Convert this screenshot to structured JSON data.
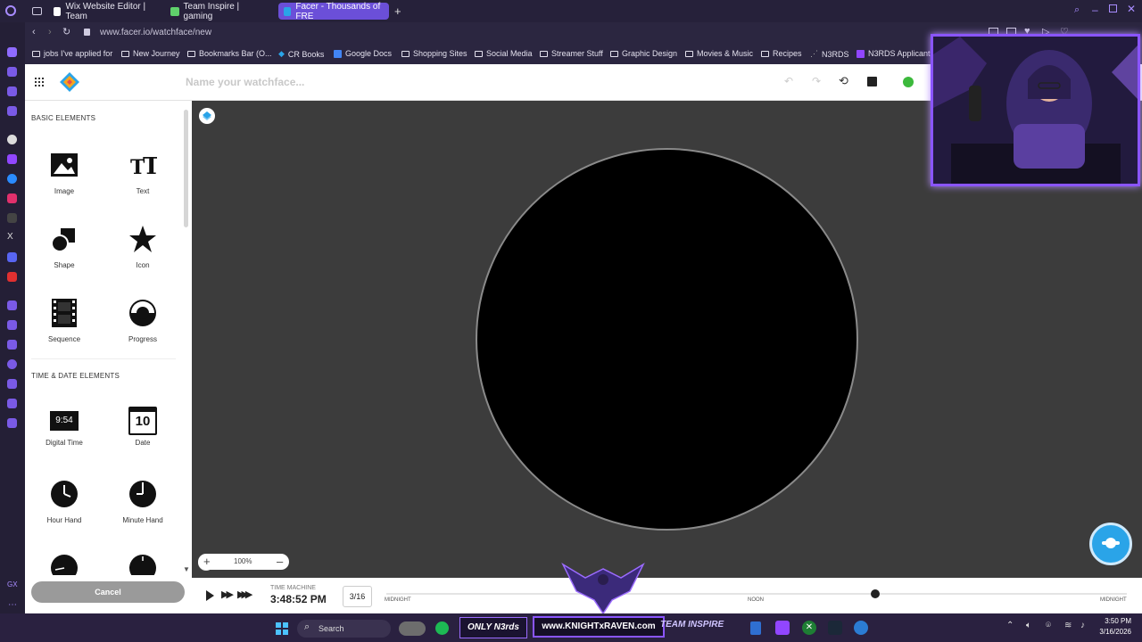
{
  "browser": {
    "tabs": [
      {
        "label": "Wix Website Editor | Team",
        "active": false
      },
      {
        "label": "Team Inspire | gaming",
        "active": false
      },
      {
        "label": "Facer - Thousands of FRE",
        "active": true
      }
    ],
    "url": "www.facer.io/watchface/new",
    "bookmarks": [
      "jobs I've applied for",
      "New Journey",
      "Bookmarks Bar (O...",
      "CR Books",
      "Google Docs",
      "Shopping Sites",
      "Social Media",
      "Streamer Stuff",
      "Graphic Design",
      "Movies & Music",
      "Recipes",
      "N3RDS",
      "N3RDS Applicanti"
    ]
  },
  "app": {
    "name_placeholder": "Name your watchface...",
    "basic_header": "BASIC ELEMENTS",
    "basic_elements": [
      {
        "label": "Image",
        "icon": "image-icon"
      },
      {
        "label": "Text",
        "icon": "text-icon"
      },
      {
        "label": "Shape",
        "icon": "shape-icon"
      },
      {
        "label": "Icon",
        "icon": "star-icon"
      },
      {
        "label": "Sequence",
        "icon": "film-icon"
      },
      {
        "label": "Progress",
        "icon": "progress-icon"
      }
    ],
    "time_header": "TIME & DATE ELEMENTS",
    "time_elements": [
      {
        "label": "Digital Time",
        "icon": "digital-time-icon",
        "sample": "9:54"
      },
      {
        "label": "Date",
        "icon": "calendar-icon",
        "sample": "10"
      },
      {
        "label": "Hour Hand",
        "icon": "hour-hand-icon"
      },
      {
        "label": "Minute Hand",
        "icon": "minute-hand-icon"
      }
    ],
    "cancel_label": "Cancel",
    "zoom": "100%"
  },
  "timeline": {
    "machine_label": "TIME MACHINE",
    "time": "3:48:52 PM",
    "date": "3/16",
    "start_label": "MIDNIGHT",
    "mid_label": "NOON",
    "end_label": "MIDNIGHT",
    "position": 0.66
  },
  "taskbar": {
    "search_label": "Search",
    "brand": "www.KNIGHTxRAVEN.com",
    "team": "TEAM INSPIRE",
    "clock_time": "3:50 PM",
    "clock_date": "3/16/2026"
  },
  "colors": {
    "accent": "#6b4fd8",
    "facer_blue": "#2aa4e8",
    "ok_green": "#3cb93c"
  }
}
